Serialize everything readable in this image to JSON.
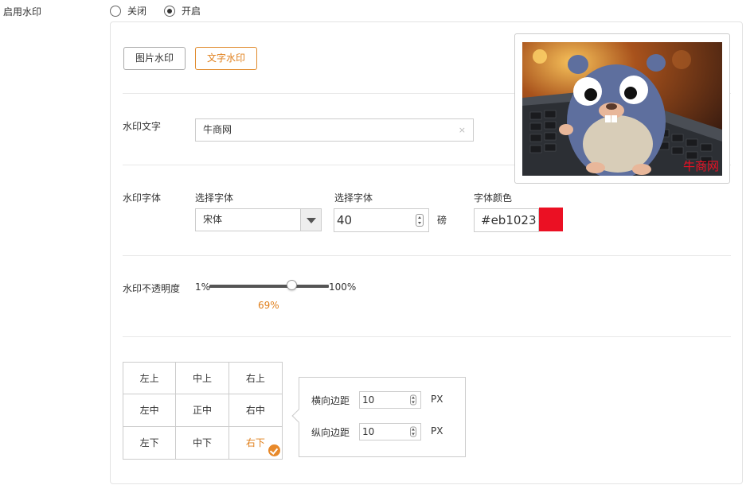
{
  "enable": {
    "label": "启用水印",
    "options": [
      {
        "label": "关闭",
        "checked": false
      },
      {
        "label": "开启",
        "checked": true
      }
    ]
  },
  "tabs": [
    {
      "label": "图片水印",
      "active": false
    },
    {
      "label": "文字水印",
      "active": true
    }
  ],
  "text_row": {
    "label": "水印文字",
    "value": "牛商网",
    "clear_glyph": "×"
  },
  "font_row": {
    "label": "水印字体",
    "font_select_label": "选择字体",
    "font_value": "宋体",
    "size_label": "选择字体",
    "size_value": "40",
    "size_unit": "磅",
    "color_label": "字体颜色",
    "color_value": "#eb1023"
  },
  "opacity_row": {
    "label": "水印不透明度",
    "min_label": "1%",
    "max_label": "100%",
    "value": 69,
    "value_label": "69%"
  },
  "position": {
    "cells": [
      "左上",
      "中上",
      "右上",
      "左中",
      "正中",
      "右中",
      "左下",
      "中下",
      "右下"
    ],
    "selected": "右下",
    "h_label": "横向边距",
    "h_value": "10",
    "v_label": "纵向边距",
    "v_value": "10",
    "unit": "PX"
  },
  "preview": {
    "watermark_text": "牛商网"
  },
  "colors": {
    "accent": "#e07f1b",
    "watermark": "#eb1023"
  }
}
